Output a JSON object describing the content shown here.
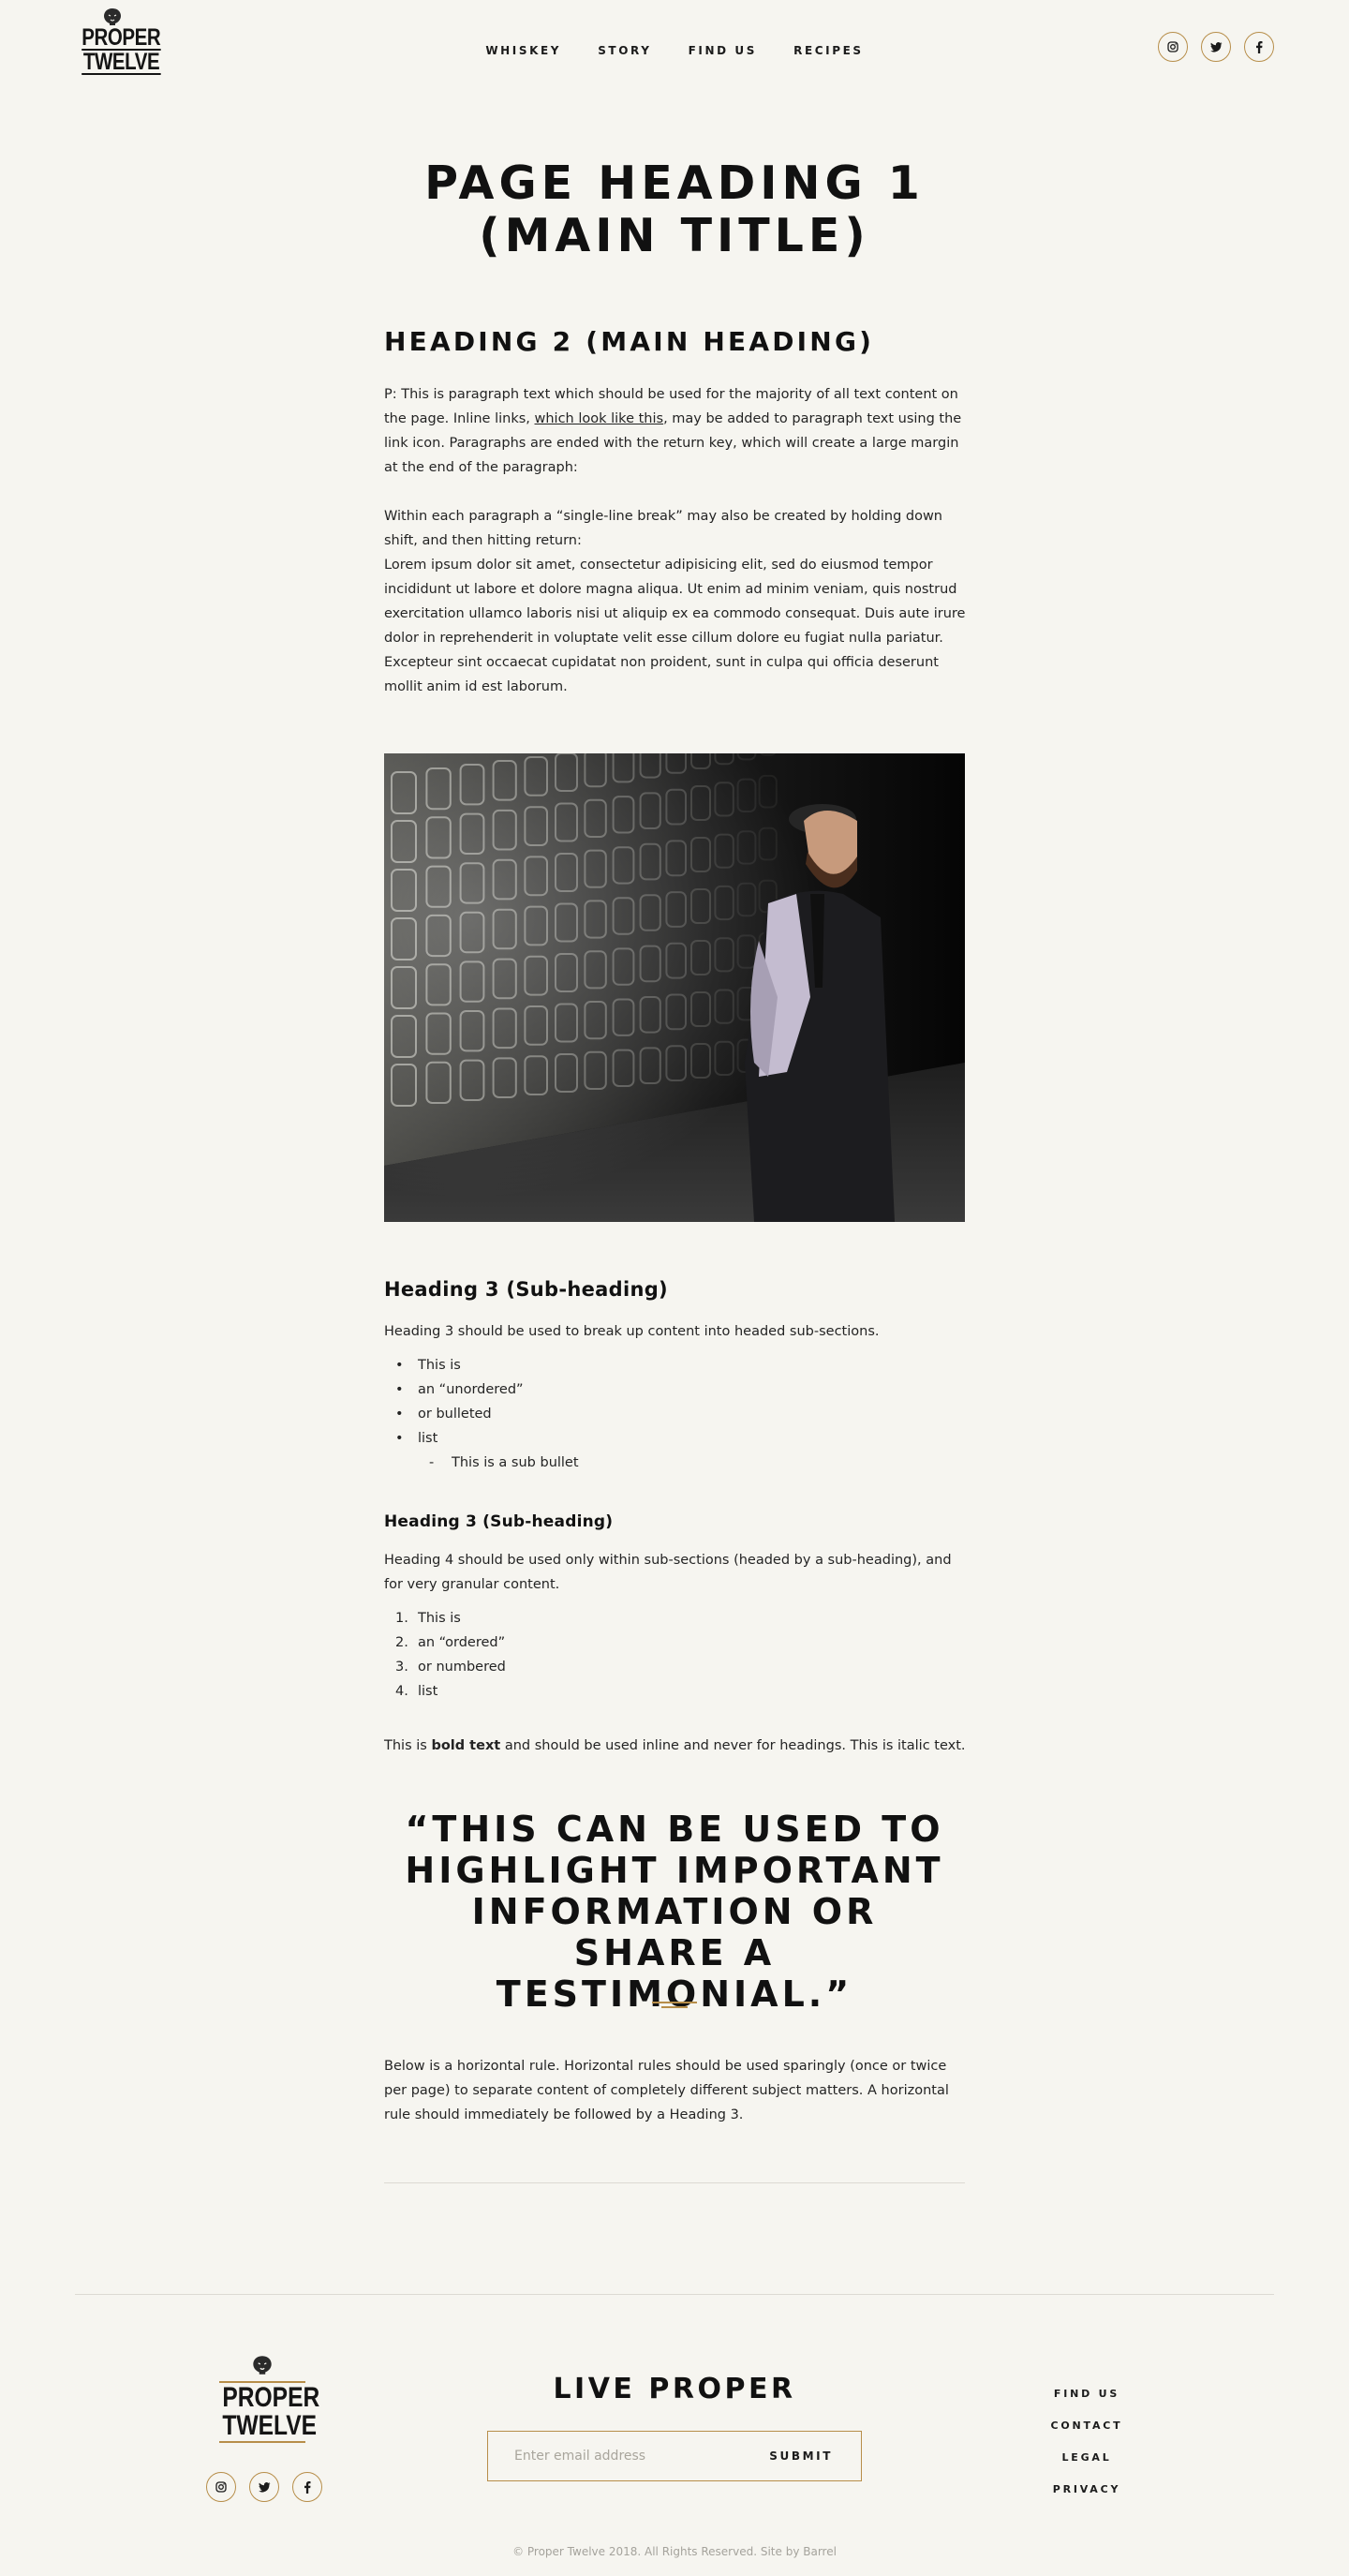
{
  "header": {
    "logo_top": "PROPER",
    "logo_bottom": "TWELVE",
    "nav": [
      "WHISKEY",
      "STORY",
      "FIND US",
      "RECIPES"
    ],
    "social_icons": [
      "instagram-icon",
      "twitter-icon",
      "facebook-icon"
    ]
  },
  "main": {
    "h1": "PAGE HEADING 1 (MAIN TITLE)",
    "h2": "HEADING 2 (MAIN HEADING)",
    "p1_before": "P: This is paragraph text which should be used for the majority of all text content on the page. Inline links, ",
    "p1_link": "which look like this",
    "p1_after": ", may be added to paragraph text using the link icon. Paragraphs are ended with the return key, which will create a large margin at the end of the paragraph:",
    "p2_line1": "Within each paragraph a “single-line break” may also be created by holding down shift, and then hitting return:",
    "p2_line2": "Lorem ipsum dolor sit amet, consectetur adipisicing elit, sed do eiusmod tempor incididunt ut labore et dolore magna aliqua. Ut enim ad minim veniam, quis nostrud exercitation ullamco laboris nisi ut aliquip ex ea commodo consequat. Duis aute irure dolor in reprehenderit in voluptate velit esse cillum dolore eu fugiat nulla pariatur. Excepteur sint occaecat cupidatat non proident, sunt in culpa qui officia deserunt mollit anim id est laborum.",
    "h3_a": "Heading 3 (Sub-heading)",
    "p3": "Heading 3 should be used to break up content into headed sub-sections.",
    "ul": [
      "This is",
      "an “unordered”",
      "or bulleted",
      "list"
    ],
    "ul_sub": "This is a sub bullet",
    "h3_b": "Heading 3 (Sub-heading)",
    "p4": "Heading 4 should be used only within sub-sections (headed by a sub-heading), and for very granular content.",
    "ol": [
      "This is",
      "an “ordered”",
      "or numbered",
      "list"
    ],
    "ol_nums": [
      "1.",
      "2.",
      "3.",
      "4."
    ],
    "p5_before": "This is ",
    "p5_bold": "bold text",
    "p5_after": " and should be used inline and never for headings. This is italic text.",
    "quote": "“THIS CAN BE USED TO HIGHLIGHT IMPORTANT INFORMATION OR SHARE A TESTIMONIAL.”",
    "p6": "Below is a horizontal rule. Horizontal rules should be used sparingly (once or twice per page) to separate content of completely different subject matters. A horizontal rule should immediately be followed by a Heading 3."
  },
  "footer": {
    "logo_top": "PROPER",
    "logo_bottom": "TWELVE",
    "heading": "LIVE PROPER",
    "email_placeholder": "Enter email address",
    "submit": "SUBMIT",
    "links": [
      "FIND US",
      "CONTACT",
      "LEGAL",
      "PRIVACY"
    ],
    "copyright": "© Proper Twelve 2018. All Rights Reserved. Site by Barrel"
  },
  "colors": {
    "background": "#f6f5f0",
    "accent_gold": "#b78e4a",
    "text": "#1b1b1b"
  }
}
